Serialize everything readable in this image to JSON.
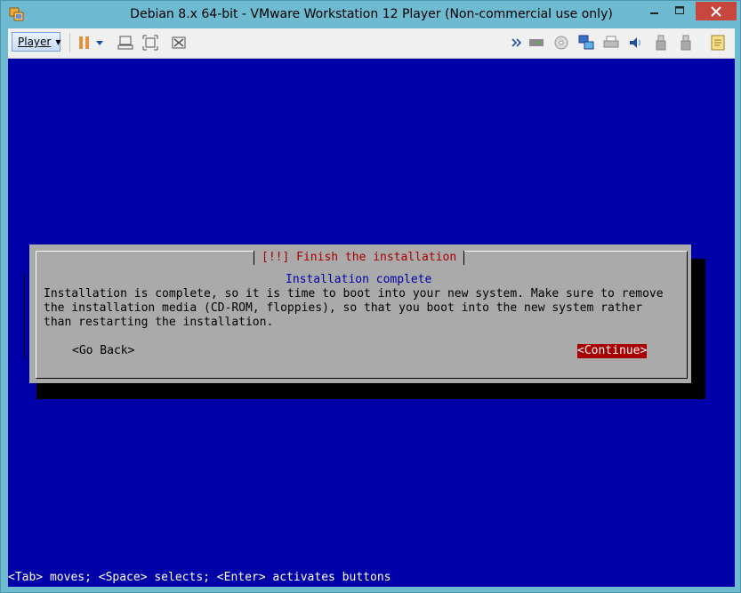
{
  "window": {
    "title": "Debian 8.x 64-bit - VMware Workstation 12 Player (Non-commercial use only)",
    "accent": "#6ebad0"
  },
  "toolbar": {
    "player_label": "Player",
    "icons": [
      "pause-icon",
      "dropdown-arrow-icon",
      "send-ctrl-alt-del-icon",
      "full-screen-icon",
      "unity-icon",
      "more-icon",
      "hard-disk-icon",
      "cd-icon",
      "network-icon",
      "printer-icon",
      "sound-icon",
      "usb-icon",
      "usb-icon-2",
      "message-log-icon"
    ]
  },
  "installer": {
    "dialog_title": "[!!] Finish the installation",
    "subtitle": "Installation complete",
    "body": "Installation is complete, so it is time to boot into your new system. Make sure to remove\nthe installation media (CD-ROM, floppies), so that you boot into the new system rather\nthan restarting the installation.",
    "go_back": "<Go Back>",
    "continue": "<Continue>",
    "status_line": "<Tab> moves; <Space> selects; <Enter> activates buttons",
    "colors": {
      "background": "#0000a8",
      "dialog": "#aaaaaa",
      "title": "#a80000",
      "subtitle": "#0000a8",
      "selected_button_bg": "#a80000"
    }
  }
}
